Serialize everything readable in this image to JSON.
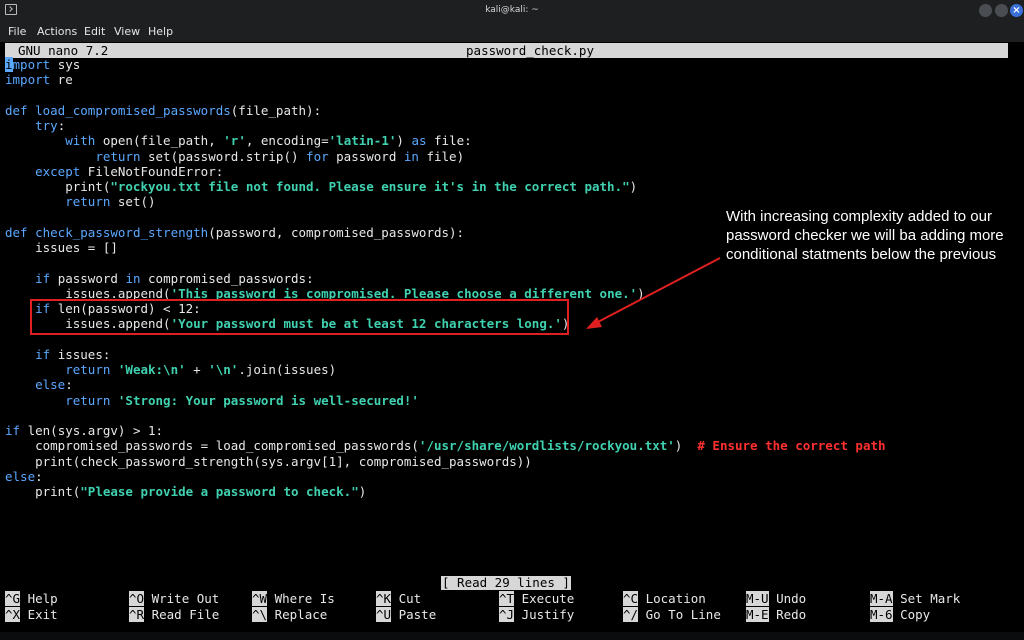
{
  "window": {
    "title": "kali@kali: ~",
    "close_glyph": "×"
  },
  "menu": [
    "File",
    "Actions",
    "Edit",
    "View",
    "Help"
  ],
  "nano": {
    "version": "GNU nano 7.2",
    "filename": "password_check.py"
  },
  "code_lines": [
    [
      [
        "c",
        "i"
      ],
      [
        "k",
        "mport"
      ],
      [
        "n",
        " sys"
      ]
    ],
    [
      [
        "k",
        "import"
      ],
      [
        "n",
        " re"
      ]
    ],
    [
      [
        "n",
        ""
      ]
    ],
    [
      [
        "k",
        "def"
      ],
      [
        "n",
        " "
      ],
      [
        "f",
        "load_compromised_passwords"
      ],
      [
        "n",
        "(file_path):"
      ]
    ],
    [
      [
        "n",
        "    "
      ],
      [
        "k",
        "try"
      ],
      [
        "n",
        ":"
      ]
    ],
    [
      [
        "n",
        "        "
      ],
      [
        "k",
        "with"
      ],
      [
        "n",
        " open(file_path, "
      ],
      [
        "s",
        "'r'"
      ],
      [
        "n",
        ", encoding="
      ],
      [
        "s",
        "'latin-1'"
      ],
      [
        "n",
        ") "
      ],
      [
        "k",
        "as"
      ],
      [
        "n",
        " file:"
      ]
    ],
    [
      [
        "n",
        "            "
      ],
      [
        "k",
        "return"
      ],
      [
        "n",
        " set(password.strip() "
      ],
      [
        "k",
        "for"
      ],
      [
        "n",
        " password "
      ],
      [
        "k",
        "in"
      ],
      [
        "n",
        " file)"
      ]
    ],
    [
      [
        "n",
        "    "
      ],
      [
        "k",
        "except"
      ],
      [
        "n",
        " FileNotFoundError:"
      ]
    ],
    [
      [
        "n",
        "        print("
      ],
      [
        "s",
        "\"rockyou.txt file not found. Please ensure it's in the correct path.\""
      ],
      [
        "n",
        ")"
      ]
    ],
    [
      [
        "n",
        "        "
      ],
      [
        "k",
        "return"
      ],
      [
        "n",
        " set()"
      ]
    ],
    [
      [
        "n",
        ""
      ]
    ],
    [
      [
        "k",
        "def"
      ],
      [
        "n",
        " "
      ],
      [
        "f",
        "check_password_strength"
      ],
      [
        "n",
        "(password, compromised_passwords):"
      ]
    ],
    [
      [
        "n",
        "    issues = []"
      ]
    ],
    [
      [
        "n",
        ""
      ]
    ],
    [
      [
        "n",
        "    "
      ],
      [
        "k",
        "if"
      ],
      [
        "n",
        " password "
      ],
      [
        "k",
        "in"
      ],
      [
        "n",
        " compromised_passwords:"
      ]
    ],
    [
      [
        "n",
        "        issues.append("
      ],
      [
        "s",
        "'This password is compromised. Please choose a different one.'"
      ],
      [
        "n",
        ")"
      ]
    ],
    [
      [
        "n",
        "    "
      ],
      [
        "k",
        "if"
      ],
      [
        "n",
        " len(password) < 12:"
      ]
    ],
    [
      [
        "n",
        "        issues.append("
      ],
      [
        "s",
        "'Your password must be at least 12 characters long.'"
      ],
      [
        "n",
        ")"
      ]
    ],
    [
      [
        "n",
        ""
      ]
    ],
    [
      [
        "n",
        "    "
      ],
      [
        "k",
        "if"
      ],
      [
        "n",
        " issues:"
      ]
    ],
    [
      [
        "n",
        "        "
      ],
      [
        "k",
        "return"
      ],
      [
        "n",
        " "
      ],
      [
        "s",
        "'Weak:\\n'"
      ],
      [
        "n",
        " + "
      ],
      [
        "s",
        "'\\n'"
      ],
      [
        "n",
        ".join(issues)"
      ]
    ],
    [
      [
        "n",
        "    "
      ],
      [
        "k",
        "else"
      ],
      [
        "n",
        ":"
      ]
    ],
    [
      [
        "n",
        "        "
      ],
      [
        "k",
        "return"
      ],
      [
        "n",
        " "
      ],
      [
        "s",
        "'Strong: Your password is well-secured!'"
      ]
    ],
    [
      [
        "n",
        ""
      ]
    ],
    [
      [
        "k",
        "if"
      ],
      [
        "n",
        " len(sys.argv) > 1:"
      ]
    ],
    [
      [
        "n",
        "    compromised_passwords = load_compromised_passwords("
      ],
      [
        "s",
        "'/usr/share/wordlists/rockyou.txt'"
      ],
      [
        "n",
        ")  "
      ],
      [
        "m",
        "# Ensure the correct path"
      ]
    ],
    [
      [
        "n",
        "    print(check_password_strength(sys.argv[1], compromised_passwords))"
      ]
    ],
    [
      [
        "k",
        "else"
      ],
      [
        "n",
        ":"
      ]
    ],
    [
      [
        "n",
        "    print("
      ],
      [
        "s",
        "\"Please provide a password to check.\""
      ],
      [
        "n",
        ")"
      ]
    ]
  ],
  "status": "[ Read 29 lines ]",
  "shortcuts": [
    {
      "key": "^G",
      "label": "Help"
    },
    {
      "key": "^O",
      "label": "Write Out"
    },
    {
      "key": "^W",
      "label": "Where Is"
    },
    {
      "key": "^K",
      "label": "Cut"
    },
    {
      "key": "^T",
      "label": "Execute"
    },
    {
      "key": "^C",
      "label": "Location"
    },
    {
      "key": "M-U",
      "label": "Undo"
    },
    {
      "key": "M-A",
      "label": "Set Mark"
    },
    {
      "key": "^X",
      "label": "Exit"
    },
    {
      "key": "^R",
      "label": "Read File"
    },
    {
      "key": "^\\",
      "label": "Replace"
    },
    {
      "key": "^U",
      "label": "Paste"
    },
    {
      "key": "^J",
      "label": "Justify"
    },
    {
      "key": "^/",
      "label": "Go To Line"
    },
    {
      "key": "M-E",
      "label": "Redo"
    },
    {
      "key": "M-6",
      "label": "Copy"
    }
  ],
  "annotation": "With increasing complexity added to our password checker we will ba adding more conditional statments below the previous",
  "colors": {
    "keyword": "#5aa8ff",
    "string": "#3fd1b0",
    "comment": "#ff3030",
    "annotation_red": "#e02020"
  }
}
